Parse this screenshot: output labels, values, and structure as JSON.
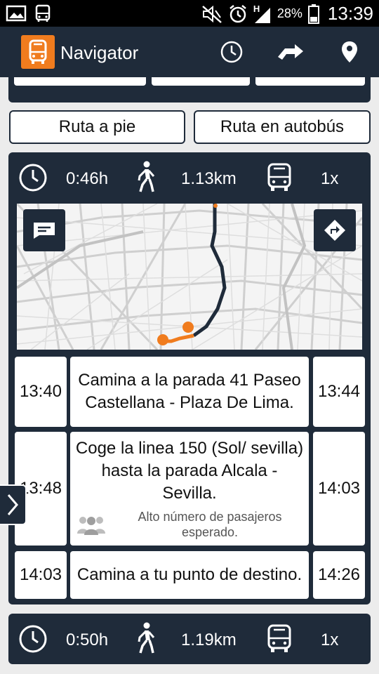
{
  "status_bar": {
    "battery_percent": "28%",
    "time": "13:39",
    "network_letter": "H",
    "icons": [
      "image-icon",
      "bus-notification-icon",
      "mute-icon",
      "alarm-icon",
      "signal-icon",
      "battery-icon"
    ]
  },
  "app_bar": {
    "title": "Navigator",
    "actions": [
      "clock-icon",
      "directions-arrow-icon",
      "location-pin-icon"
    ]
  },
  "tabs": {
    "walk": "Ruta a pie",
    "bus": "Ruta en autobús"
  },
  "routes": [
    {
      "duration": "0:46h",
      "distance": "1.13km",
      "bus_count": "1x",
      "steps": [
        {
          "start": "13:40",
          "text": "Camina a la parada 41 Paseo Castellana - Plaza De Lima.",
          "end": "13:44"
        },
        {
          "start": "13:48",
          "text": "Coge la linea 150 (Sol/ sevilla) hasta la parada Alcala - Sevilla.",
          "end": "14:03",
          "note": "Alto número de pasajeros esperado."
        },
        {
          "start": "14:03",
          "text": "Camina a tu punto de destino.",
          "end": "14:26"
        }
      ]
    },
    {
      "duration": "0:50h",
      "distance": "1.19km",
      "bus_count": "1x"
    }
  ],
  "colors": {
    "primary": "#1f2b3a",
    "accent": "#f07c1e",
    "route_line": "#1f2b3a",
    "walk_line": "#f07c1e"
  }
}
